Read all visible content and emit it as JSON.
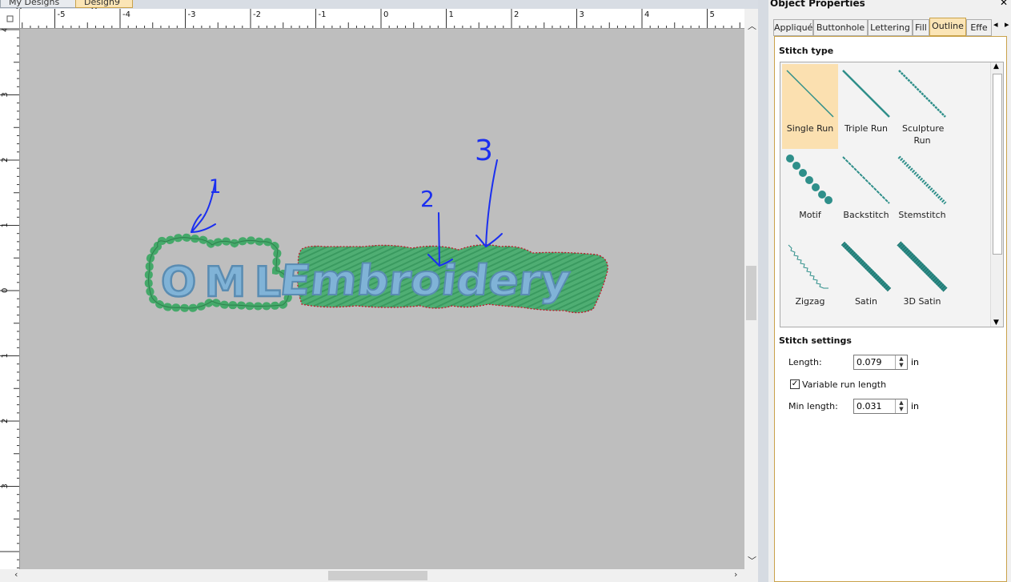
{
  "window_tabs": [
    {
      "label": "My Designs"
    },
    {
      "label": "Design9"
    }
  ],
  "ruler": {
    "top_ticks": [
      "-5",
      "-4",
      "-3",
      "-2",
      "-1",
      "0",
      "1",
      "2",
      "3",
      "4",
      "5"
    ],
    "left_ticks": [
      "4",
      "3",
      "2",
      "1",
      "0",
      "1",
      "2",
      "3"
    ]
  },
  "annotations": {
    "one": "1",
    "two": "2",
    "three": "3"
  },
  "design": {
    "text1": "OML",
    "text2": "Embroidery"
  },
  "colors": {
    "accent": "#fbe5b6",
    "outline_green": "#45a96a",
    "fill_green": "#56b378",
    "lettering_blue": "#7fb2d6",
    "annotation_blue": "#1b2ff0",
    "stitch_teal": "#2f8f8a"
  },
  "properties": {
    "title": "Object Properties",
    "tabs": [
      {
        "label": "Appliqué"
      },
      {
        "label": "Buttonhole"
      },
      {
        "label": "Lettering"
      },
      {
        "label": "Fill"
      },
      {
        "label": "Outline",
        "active": true
      },
      {
        "label": "Effe"
      }
    ],
    "stitch_type": {
      "title": "Stitch type",
      "items": [
        {
          "label": "Single Run",
          "icon": "single-run-icon",
          "selected": true
        },
        {
          "label": "Triple Run",
          "icon": "triple-run-icon"
        },
        {
          "label": "Sculpture Run",
          "icon": "sculpture-run-icon"
        },
        {
          "label": "Motif",
          "icon": "motif-icon"
        },
        {
          "label": "Backstitch",
          "icon": "backstitch-icon"
        },
        {
          "label": "Stemstitch",
          "icon": "stemstitch-icon"
        },
        {
          "label": "Zigzag",
          "icon": "zigzag-icon"
        },
        {
          "label": "Satin",
          "icon": "satin-icon"
        },
        {
          "label": "3D Satin",
          "icon": "3d-satin-icon"
        }
      ]
    },
    "stitch_settings": {
      "title": "Stitch settings",
      "length_label": "Length:",
      "length_value": "0.079",
      "length_unit": "in",
      "variable_label": "Variable run length",
      "variable_checked": true,
      "min_length_label": "Min length:",
      "min_length_value": "0.031",
      "min_length_unit": "in"
    }
  }
}
